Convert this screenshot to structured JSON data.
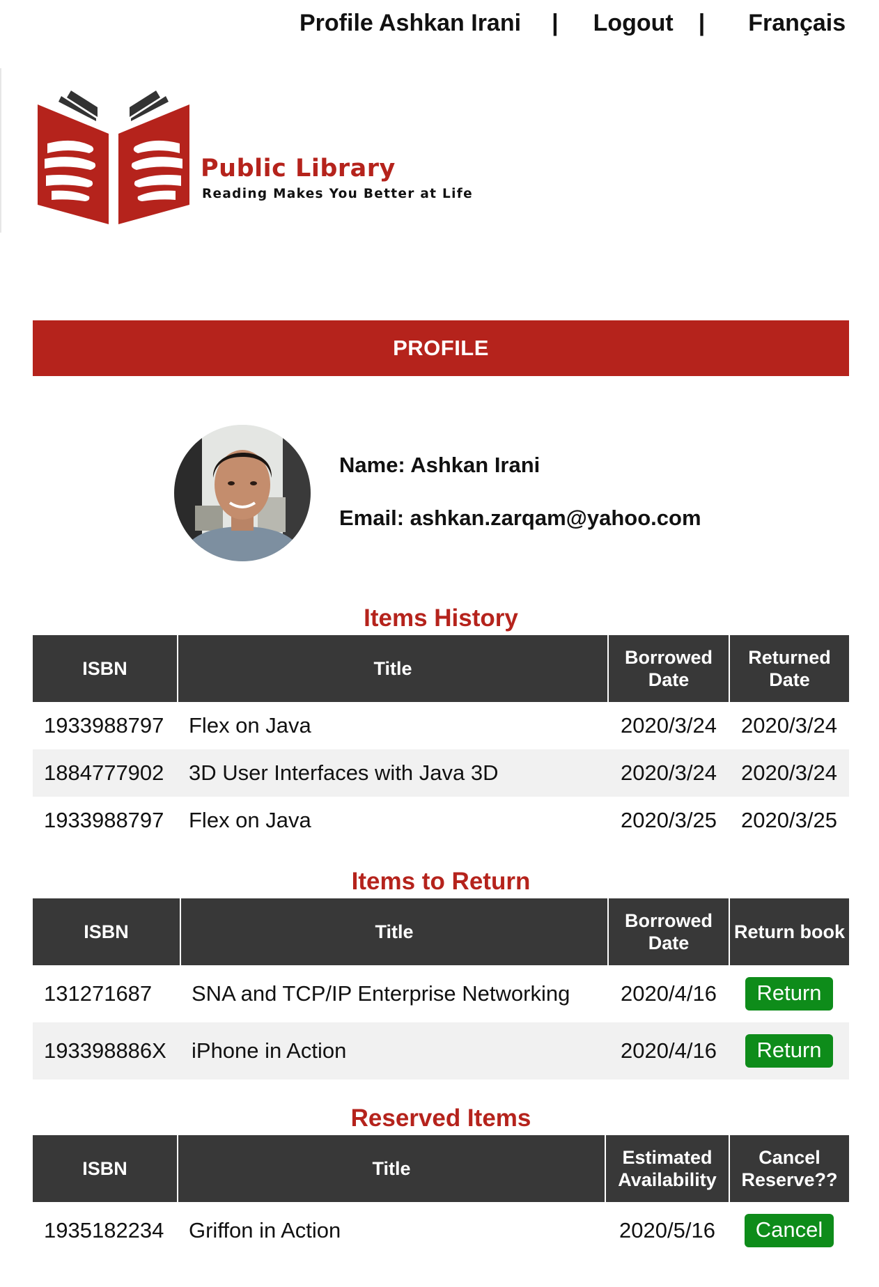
{
  "nav": {
    "profile_label": "Profile Ashkan Irani",
    "separator": "|",
    "logout_label": "Logout",
    "language_label": "Français"
  },
  "logo": {
    "title": "Public Library",
    "tagline": "Reading Makes You Better at Life"
  },
  "banner": {
    "title": "PROFILE"
  },
  "user": {
    "name": "Name: Ashkan Irani",
    "email": "Email: ashkan.zarqam@yahoo.com"
  },
  "history": {
    "title": "Items History",
    "headers": [
      "ISBN",
      "Title",
      "Borrowed Date",
      "Returned Date"
    ],
    "rows": [
      [
        "1933988797",
        "Flex on Java",
        "2020/3/24",
        "2020/3/24"
      ],
      [
        "1884777902",
        "3D User Interfaces with Java 3D",
        "2020/3/24",
        "2020/3/24"
      ],
      [
        "1933988797",
        "Flex on Java",
        "2020/3/25",
        "2020/3/25"
      ]
    ]
  },
  "to_return": {
    "title": "Items to Return",
    "headers": [
      "ISBN",
      "Title",
      "Borrowed Date",
      "Return book"
    ],
    "button_label": "Return",
    "rows": [
      [
        "131271687",
        "SNA and TCP/IP Enterprise Networking",
        "2020/4/16"
      ],
      [
        "193398886X",
        "iPhone in Action",
        "2020/4/16"
      ]
    ]
  },
  "reserved": {
    "title": "Reserved Items",
    "headers": [
      "ISBN",
      "Title",
      "Estimated Availability",
      "Cancel Reserve??"
    ],
    "button_label": "Cancel",
    "rows": [
      [
        "1935182234",
        "Griffon in Action",
        "2020/5/16"
      ]
    ]
  },
  "colors": {
    "brand_red": "#b5231c",
    "header_dark": "#383838",
    "button_green": "#0e8c1a",
    "row_alt": "#f1f1f1"
  }
}
